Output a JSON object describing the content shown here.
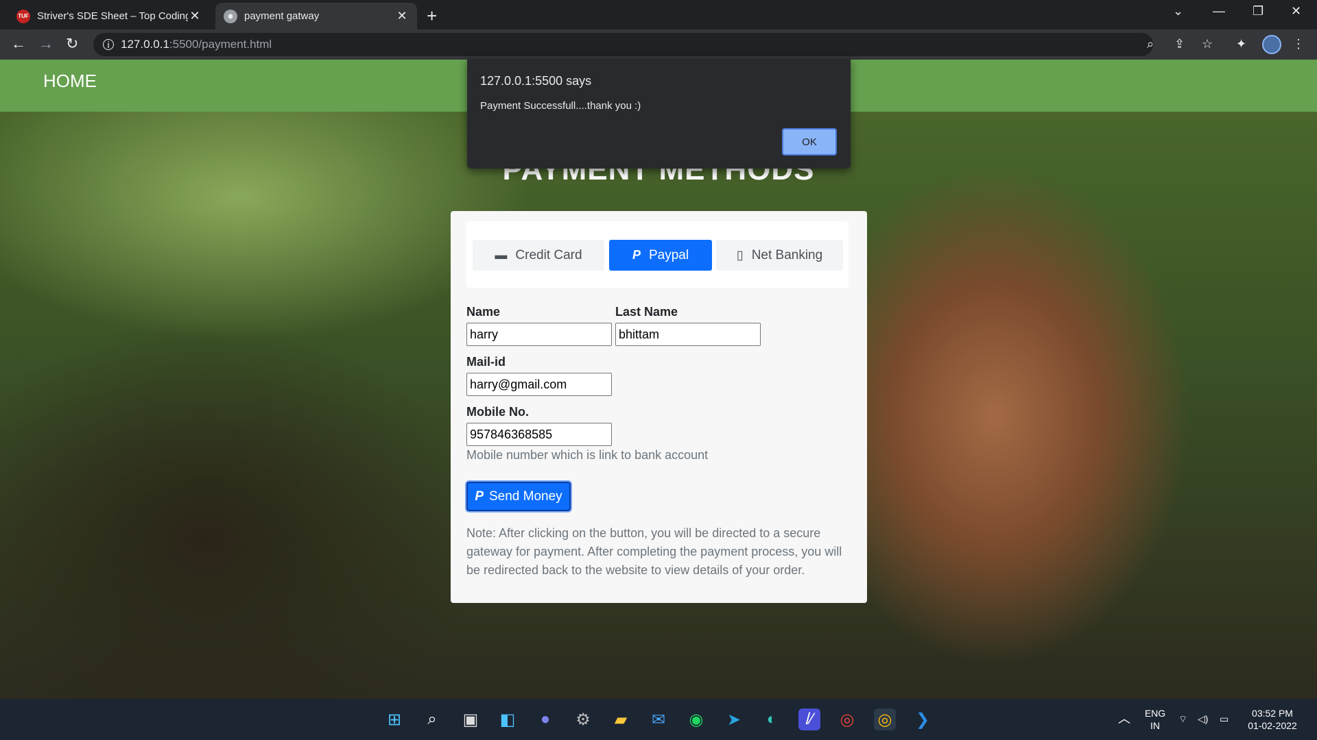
{
  "browser": {
    "tabs": [
      {
        "title": "Striver's SDE Sheet – Top Coding",
        "favicon": "TUF"
      },
      {
        "title": "payment gatway",
        "favicon": "globe-icon"
      }
    ],
    "url_host": "127.0.0.1",
    "url_path": ":5500/payment.html"
  },
  "page": {
    "nav_home": "HOME",
    "heading": "PAYMENT METHODS",
    "tabs": [
      {
        "label": "Credit Card",
        "icon": "credit-card-icon"
      },
      {
        "label": "Paypal",
        "icon": "paypal-icon"
      },
      {
        "label": "Net Banking",
        "icon": "mobile-icon"
      }
    ],
    "form": {
      "name_label": "Name",
      "name_value": "harry",
      "lastname_label": "Last Name",
      "lastname_value": "bhittam",
      "mail_label": "Mail-id",
      "mail_value": "harry@gmail.com",
      "mobile_label": "Mobile No.",
      "mobile_value": "957846368585",
      "mobile_help": "Mobile number which is link to bank account",
      "send_label": "Send Money",
      "note": "Note: After clicking on the button, you will be directed to a secure gateway for payment. After completing the payment process, you will be redirected back to the website to view details of your order."
    }
  },
  "dialog": {
    "title": "127.0.0.1:5500 says",
    "message": "Payment Successfull....thank you :)",
    "ok_label": "OK"
  },
  "taskbar": {
    "lang_top": "ENG",
    "lang_bottom": "IN",
    "time": "03:52 PM",
    "date": "01-02-2022"
  },
  "colors": {
    "navbar": "#65a14f",
    "primary": "#0d6efd"
  }
}
